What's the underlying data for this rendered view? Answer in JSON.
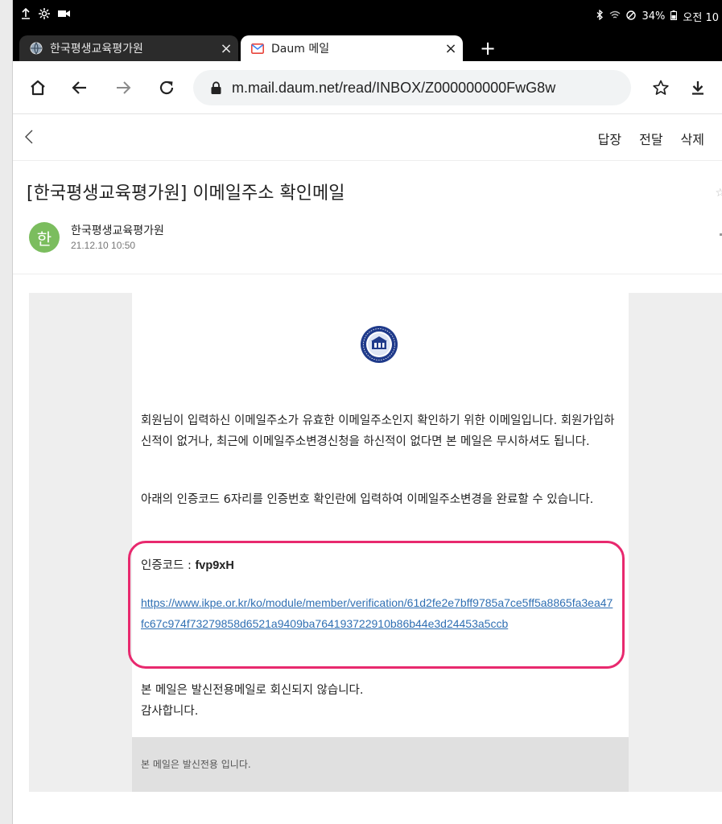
{
  "status_bar": {
    "left_icons": [
      "upload-icon",
      "settings-icon",
      "camera-icon"
    ],
    "right_text": "34%",
    "clock": "오전 10"
  },
  "tabs": [
    {
      "title": "한국평생교육평가원",
      "icon": "globe-icon",
      "active": false
    },
    {
      "title": "Daum 메일",
      "icon": "mail-icon",
      "active": true
    }
  ],
  "new_tab_label": "+",
  "address_bar": {
    "url": "m.mail.daum.net/read/INBOX/Z000000000FwG8w"
  },
  "mail_actions": {
    "reply": "답장",
    "forward": "전달",
    "delete": "삭제"
  },
  "message": {
    "subject": "[한국평생교육평가원] 이메일주소 확인메일",
    "avatar_initial": "한",
    "sender": "한국평생교육평가원",
    "date": "21.12.10 10:50",
    "body": {
      "paragraph1": "회원님이 입력하신 이메일주소가 유효한 이메일주소인지 확인하기 위한 이메일입니다. 회원가입하신적이 없거나, 최근에 이메일주소변경신청을 하신적이 없다면 본 메일은 무시하셔도 됩니다.",
      "paragraph2": "아래의 인증코드 6자리를 인증번호 확인란에 입력하여 이메일주소변경을 완료할 수 있습니다.",
      "code_label": "인증코드 : ",
      "code_value": "fvp9xH",
      "verification_link": "https://www.ikpe.or.kr/ko/module/member/verification/61d2fe2e7bff9785a7ce5ff5a8865fa3ea47fc67c974f73279858d6521a9409ba764193722910b86b44e3d24453a5ccb",
      "closing_line1": "본 메일은 발신전용메일로 회신되지 않습니다.",
      "closing_line2": "감사합니다.",
      "footer": "본 메일은 발신전용 입니다."
    }
  },
  "colors": {
    "highlight": "#e8296e",
    "link": "#2f6fb3",
    "avatar": "#7bbd5e"
  }
}
